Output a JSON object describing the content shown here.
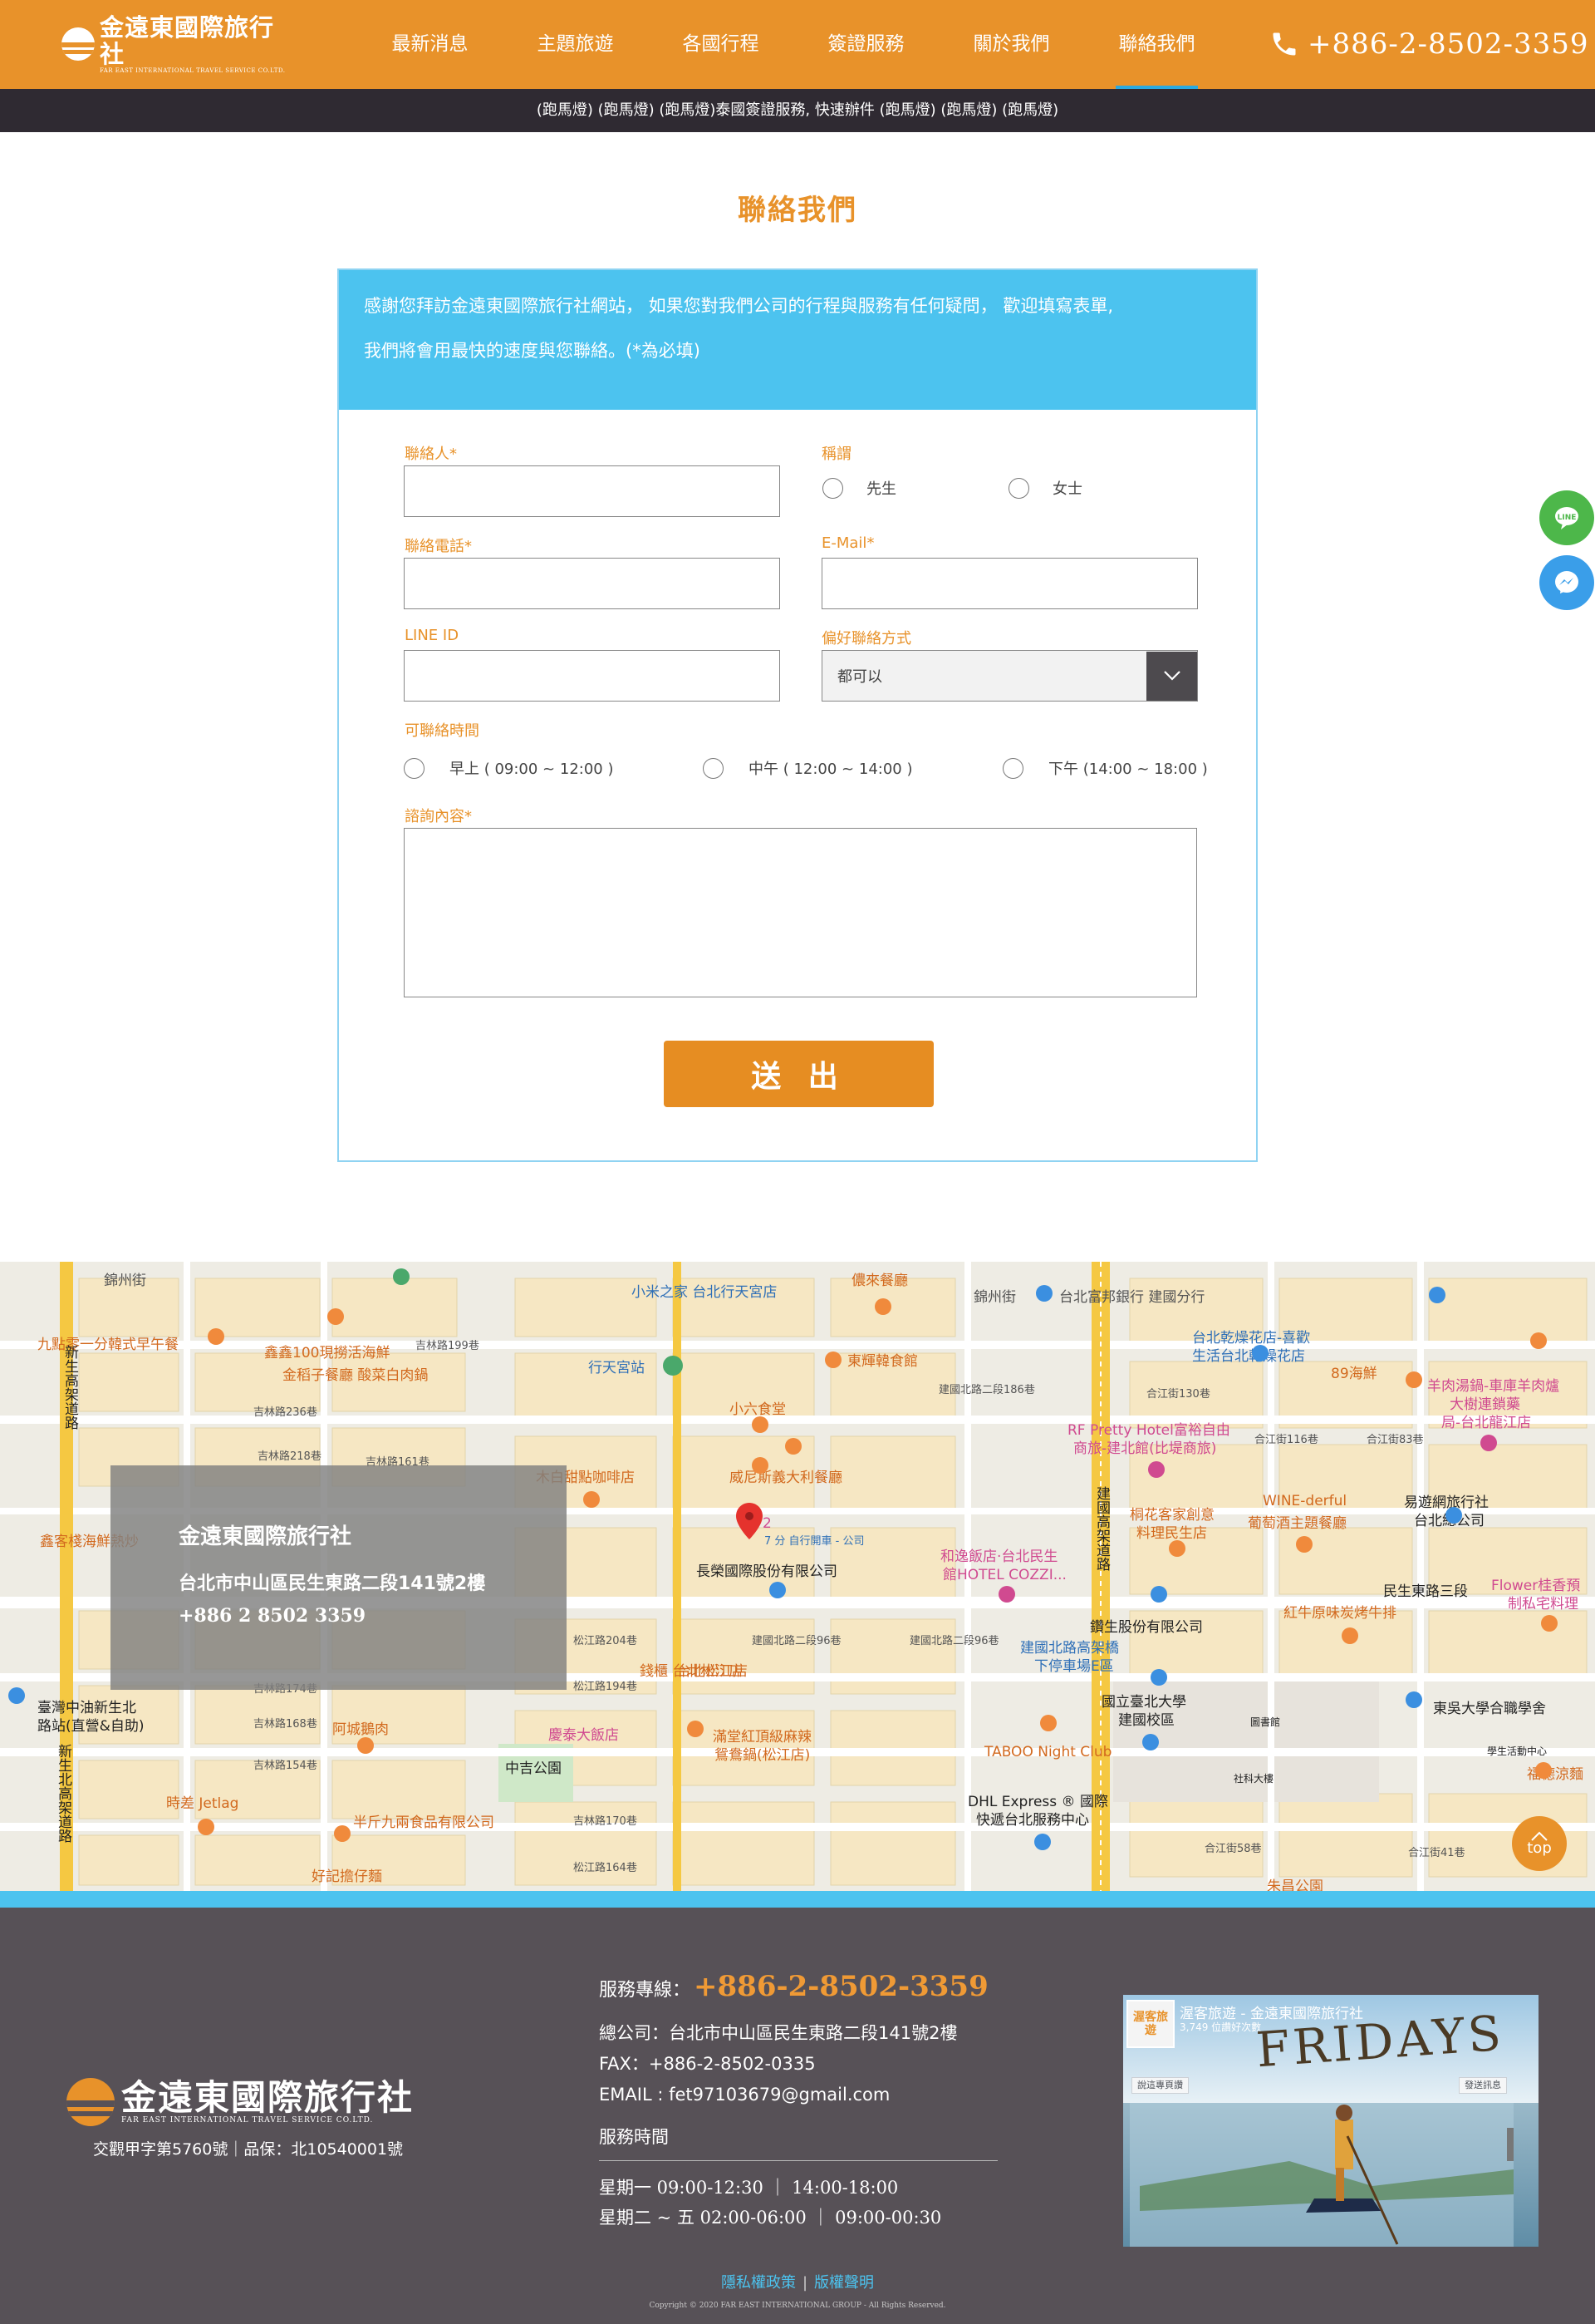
{
  "header": {
    "logo_zh": "金遠東國際旅行社",
    "logo_en": "FAR EAST INTERNATIONAL TRAVEL SERVICE CO.LTD.",
    "nav": [
      "最新消息",
      "主題旅遊",
      "各國行程",
      "簽證服務",
      "關於我們",
      "聯絡我們"
    ],
    "active_nav": "聯絡我們",
    "phone": "+886-2-8502-3359"
  },
  "marquee": "(跑馬燈) (跑馬燈) (跑馬燈)泰國簽證服務, 快速辦件 (跑馬燈) (跑馬燈) (跑馬燈)",
  "page_title": "聯絡我們",
  "form": {
    "intro_line1": "感謝您拜訪金遠東國際旅行社網站， 如果您對我們公司的行程與服務有任何疑問， 歡迎填寫表單,",
    "intro_line2": "我們將會用最快的速度與您聯絡。(*為必填)",
    "contact_label": "聯絡人",
    "title_label": "稱謂",
    "title_opt1": "先生",
    "title_opt2": "女士",
    "phone_label": "聯絡電話",
    "email_label": "E-Mail",
    "lineid_label": "LINE ID",
    "pref_label": "偏好聯絡方式",
    "pref_value": "都可以",
    "time_label": "可聯絡時間",
    "time_opt1": "早上 ( 09:00 ~ 12:00 )",
    "time_opt2": "中午 ( 12:00 ~ 14:00 )",
    "time_opt3": "下午 (14:00 ~ 18:00 )",
    "inquiry_label": "諮詢內容",
    "required_mark": "*",
    "submit_label": "送 出"
  },
  "map": {
    "info_name": "金遠東國際旅行社",
    "info_addr": "台北市中山區民生東路二段141號2樓",
    "info_tel": "+886 2 8502 3359",
    "pin_label": "2",
    "pin_sub": "7 分 自行開車 - 公司",
    "labels": [
      "錦州街",
      "小米之家 台北行天宮店",
      "儂來餐廳",
      "錦州街",
      "台北富邦銀行 建國分行",
      "九點零一分韓式早午餐",
      "鑫鑫100現撈活海鮮",
      "金稻子餐廳 酸菜白肉鍋",
      "吉林路199巷",
      "行天宮站",
      "東輝韓食館",
      "台北乾燥花店-喜歡",
      "生活台北乾燥花店",
      "89海鮮",
      "羊肉湯鍋-車庫羊肉爐",
      "大樹連鎖藥",
      "局-台北龍江店",
      "小六食堂",
      "建國北路二段186巷",
      "合江街130巷",
      "吉林路236巷",
      "吉林路218巷",
      "吉林路161巷",
      "木白甜點咖啡店",
      "威尼斯義大利餐廳",
      "RF Pretty Hotel富裕自由",
      "商旅-建北館(比堤商旅)",
      "合江街116巷",
      "合江街83巷",
      "易遊網旅行社",
      "台北總公司",
      "WINE-derful",
      "葡萄酒主題餐廳",
      "桐花客家創意",
      "料理民生店",
      "鑫客棧海鮮熱炒",
      "長榮國際股份有限公司",
      "和逸飯店·台北民生",
      "館HOTEL COZZI...",
      "民生東路三段",
      "Flower桂香預",
      "制私宅料理",
      "鑽生股份有限公司",
      "紅牛原味炭烤牛排",
      "建國北路高架橋",
      "下停車場E區",
      "松江路204巷",
      "建國北路二段96巷",
      "建國北路二段96巷",
      "台北松江店",
      "松江路194巷",
      "臺灣中油新生北",
      "路站(直營&自助)",
      "錢櫃 台北松江店",
      "國立臺北大學",
      "建國校區",
      "東吳大學合職學舍",
      "吉林路174巷",
      "吉林路168巷",
      "阿城鵝肉",
      "慶泰大飯店",
      "滿堂紅頂級麻辣",
      "鴛鴦鍋(松江店)",
      "TABOO Night Club",
      "圖書館",
      "學生活動中心",
      "中吉公園",
      "吉林路154巷",
      "時差 Jetlag",
      "半斤九兩食品有限公司",
      "DHL Express ® 國際",
      "快遞台北服務中心",
      "社科大樓",
      "福德涼麵",
      "吉林路170巷",
      "松江路164巷",
      "好記擔仔麵",
      "合江街58巷",
      "合江街41巷",
      "朱昌公園",
      "新生高架道路",
      "新生北高架道路",
      "建國高架道路"
    ]
  },
  "top_button": "top",
  "footer": {
    "logo_zh": "金遠東國際旅行社",
    "logo_en": "FAR EAST INTERNATIONAL TRAVEL SERVICE CO.LTD.",
    "license": "交觀甲字第5760號｜品保：北10540001號",
    "hotline_label": "服務專線：",
    "hotline": "+886-2-8502-3359",
    "address": "總公司：台北市中山區民生東路二段141號2樓",
    "fax": "FAX：+886-2-8502-0335",
    "email": "EMAIL : fet97103679@gmail.com",
    "hours_title": "服務時間",
    "hours1": "星期一  09:00-12:30 ｜ 14:00-18:00",
    "hours2": "星期二 ~ 五  02:00-06:00 ｜ 09:00-00:30",
    "privacy": "隱私權政策",
    "copyright_link": "版權聲明",
    "copyright": "Copyright © 2020 FAR EAST INTERNATIONAL GROUP - All Rights Reserved.",
    "fb_page_name": "渥客旅遊 - 金遠東國際旅行社",
    "fb_likes": "3,749 位讚好次數",
    "fb_like_btn": "說這專頁讚",
    "fb_msg_btn": "發送訊息",
    "fb_banner_text": "FRIDAYS",
    "fb_badge": "渥客旅遊"
  }
}
